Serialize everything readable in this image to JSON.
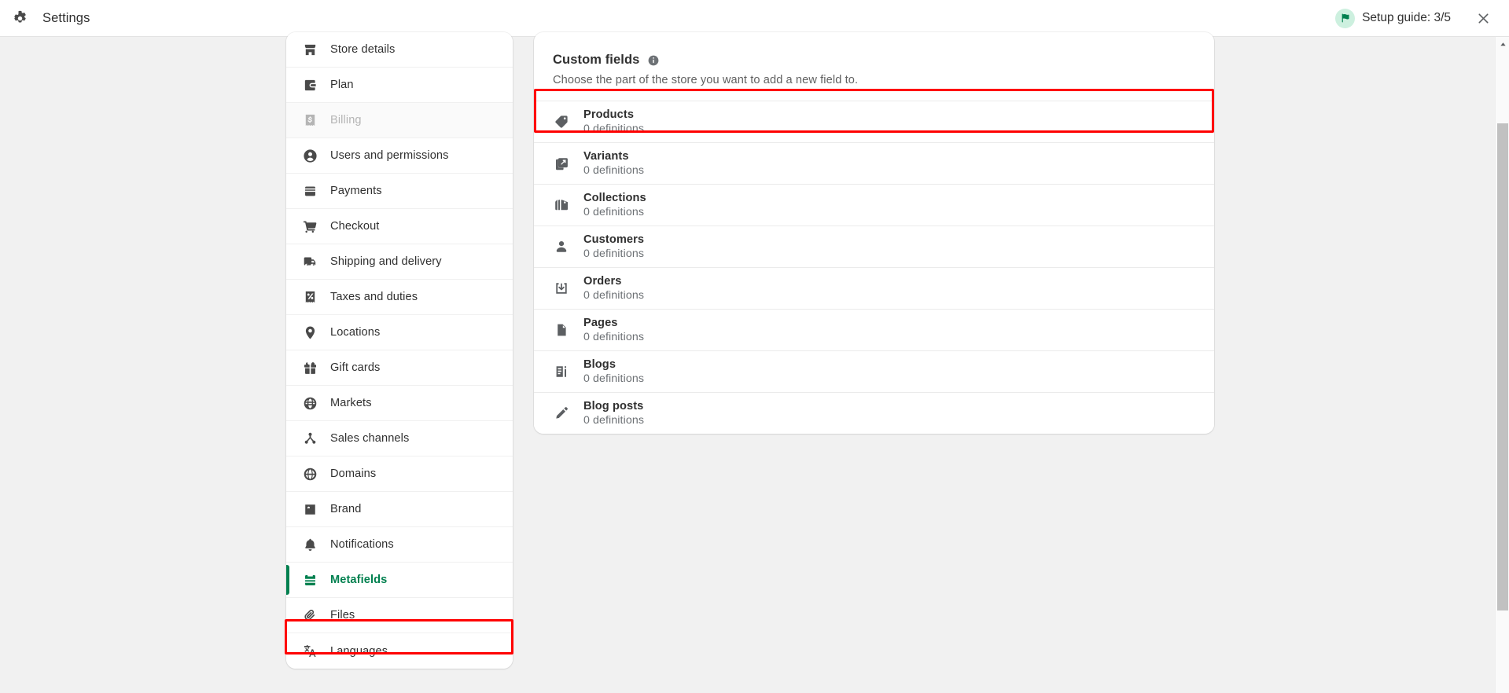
{
  "topbar": {
    "gear_icon": "gear-icon",
    "app_title": "Settings",
    "setup_guide_label": "Setup guide: 3/5",
    "setup_flag_icon": "flag-icon",
    "close_icon": "close-icon",
    "badge_color": "#cdf0df"
  },
  "sidebar": {
    "items": [
      {
        "label": "Store details",
        "icon": "store-icon",
        "state": "normal"
      },
      {
        "label": "Plan",
        "icon": "wallet-icon",
        "state": "normal"
      },
      {
        "label": "Billing",
        "icon": "receipt-dollar-icon",
        "state": "disabled"
      },
      {
        "label": "Users and permissions",
        "icon": "person-circle-icon",
        "state": "normal"
      },
      {
        "label": "Payments",
        "icon": "payments-icon",
        "state": "normal"
      },
      {
        "label": "Checkout",
        "icon": "cart-icon",
        "state": "normal"
      },
      {
        "label": "Shipping and delivery",
        "icon": "truck-icon",
        "state": "normal"
      },
      {
        "label": "Taxes and duties",
        "icon": "receipt-percent-icon",
        "state": "normal"
      },
      {
        "label": "Locations",
        "icon": "map-pin-icon",
        "state": "normal"
      },
      {
        "label": "Gift cards",
        "icon": "gift-icon",
        "state": "normal"
      },
      {
        "label": "Markets",
        "icon": "globe-target-icon",
        "state": "normal"
      },
      {
        "label": "Sales channels",
        "icon": "channels-icon",
        "state": "normal"
      },
      {
        "label": "Domains",
        "icon": "globe-icon",
        "state": "normal"
      },
      {
        "label": "Brand",
        "icon": "image-icon",
        "state": "normal"
      },
      {
        "label": "Notifications",
        "icon": "bell-icon",
        "state": "normal"
      },
      {
        "label": "Metafields",
        "icon": "metafields-icon",
        "state": "active"
      },
      {
        "label": "Files",
        "icon": "paperclip-icon",
        "state": "normal"
      },
      {
        "label": "Languages",
        "icon": "translate-icon",
        "state": "normal"
      }
    ],
    "active_color": "#00804f"
  },
  "main": {
    "title": "Custom fields",
    "info_icon": "info-icon",
    "subtitle": "Choose the part of the store you want to add a new field to.",
    "resources": [
      {
        "name": "Products",
        "count": "0 definitions",
        "icon": "tag-icon",
        "highlighted": true
      },
      {
        "name": "Variants",
        "count": "0 definitions",
        "icon": "variants-icon",
        "highlighted": false
      },
      {
        "name": "Collections",
        "count": "0 definitions",
        "icon": "collections-icon",
        "highlighted": false
      },
      {
        "name": "Customers",
        "count": "0 definitions",
        "icon": "person-icon",
        "highlighted": false
      },
      {
        "name": "Orders",
        "count": "0 definitions",
        "icon": "orders-icon",
        "highlighted": false
      },
      {
        "name": "Pages",
        "count": "0 definitions",
        "icon": "page-icon",
        "highlighted": false
      },
      {
        "name": "Blogs",
        "count": "0 definitions",
        "icon": "blog-icon",
        "highlighted": false
      },
      {
        "name": "Blog posts",
        "count": "0 definitions",
        "icon": "pencil-icon",
        "highlighted": false
      }
    ]
  },
  "annotations": {
    "color": "#ff0000",
    "targets": [
      "products-row",
      "sidebar-item-metafields"
    ]
  },
  "scrollbar": {
    "up_arrow_icon": "caret-up-icon"
  }
}
